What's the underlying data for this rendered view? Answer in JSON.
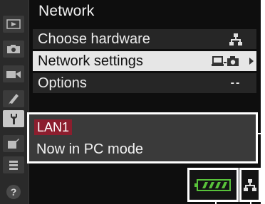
{
  "menu": {
    "title": "Network",
    "items": [
      {
        "label": "Choose hardware",
        "value_icon": "network-icon",
        "selected": false
      },
      {
        "label": "Network settings",
        "value_icon": "computer-camera-icon",
        "selected": true
      },
      {
        "label": "Options",
        "value_text": "--",
        "selected": false
      }
    ]
  },
  "sidebar": {
    "tabs": [
      {
        "icon": "playback-icon"
      },
      {
        "icon": "photo-shooting-icon"
      },
      {
        "icon": "movie-shooting-icon"
      },
      {
        "icon": "pencil-icon"
      },
      {
        "icon": "setup-wrench-icon",
        "active": true
      },
      {
        "icon": "retouch-icon"
      },
      {
        "icon": "my-menu-icon"
      },
      {
        "icon": "help-icon"
      }
    ]
  },
  "status": {
    "connection_name": "LAN1",
    "mode_message": "Now in PC mode",
    "signal_icon": "wired-lan-signal-icon",
    "network_icon": "network-icon"
  },
  "colors": {
    "badge": "#8c1e2e",
    "selected_row": "#e6e6e6",
    "signal_green": "#58c23a"
  }
}
